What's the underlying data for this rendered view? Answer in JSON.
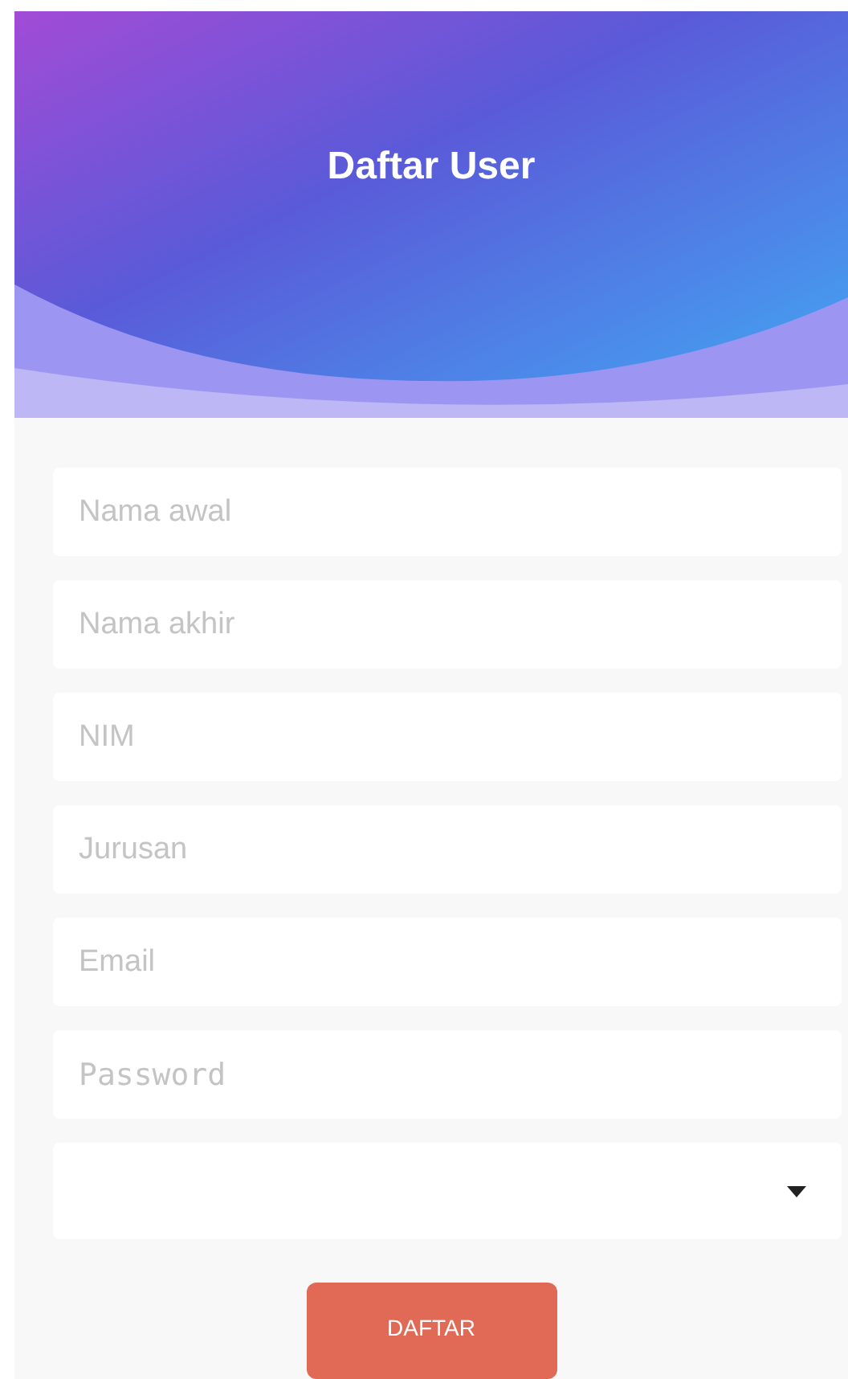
{
  "header": {
    "title": "Daftar User"
  },
  "fields": [
    {
      "kind": "text",
      "placeholder": "Nama awal"
    },
    {
      "kind": "text",
      "placeholder": "Nama akhir"
    },
    {
      "kind": "text",
      "placeholder": "NIM"
    },
    {
      "kind": "text",
      "placeholder": "Jurusan"
    },
    {
      "kind": "text",
      "placeholder": "Email"
    },
    {
      "kind": "password",
      "placeholder": "Password"
    },
    {
      "kind": "select"
    }
  ],
  "submit_button": {
    "label": "DAFTAR"
  }
}
